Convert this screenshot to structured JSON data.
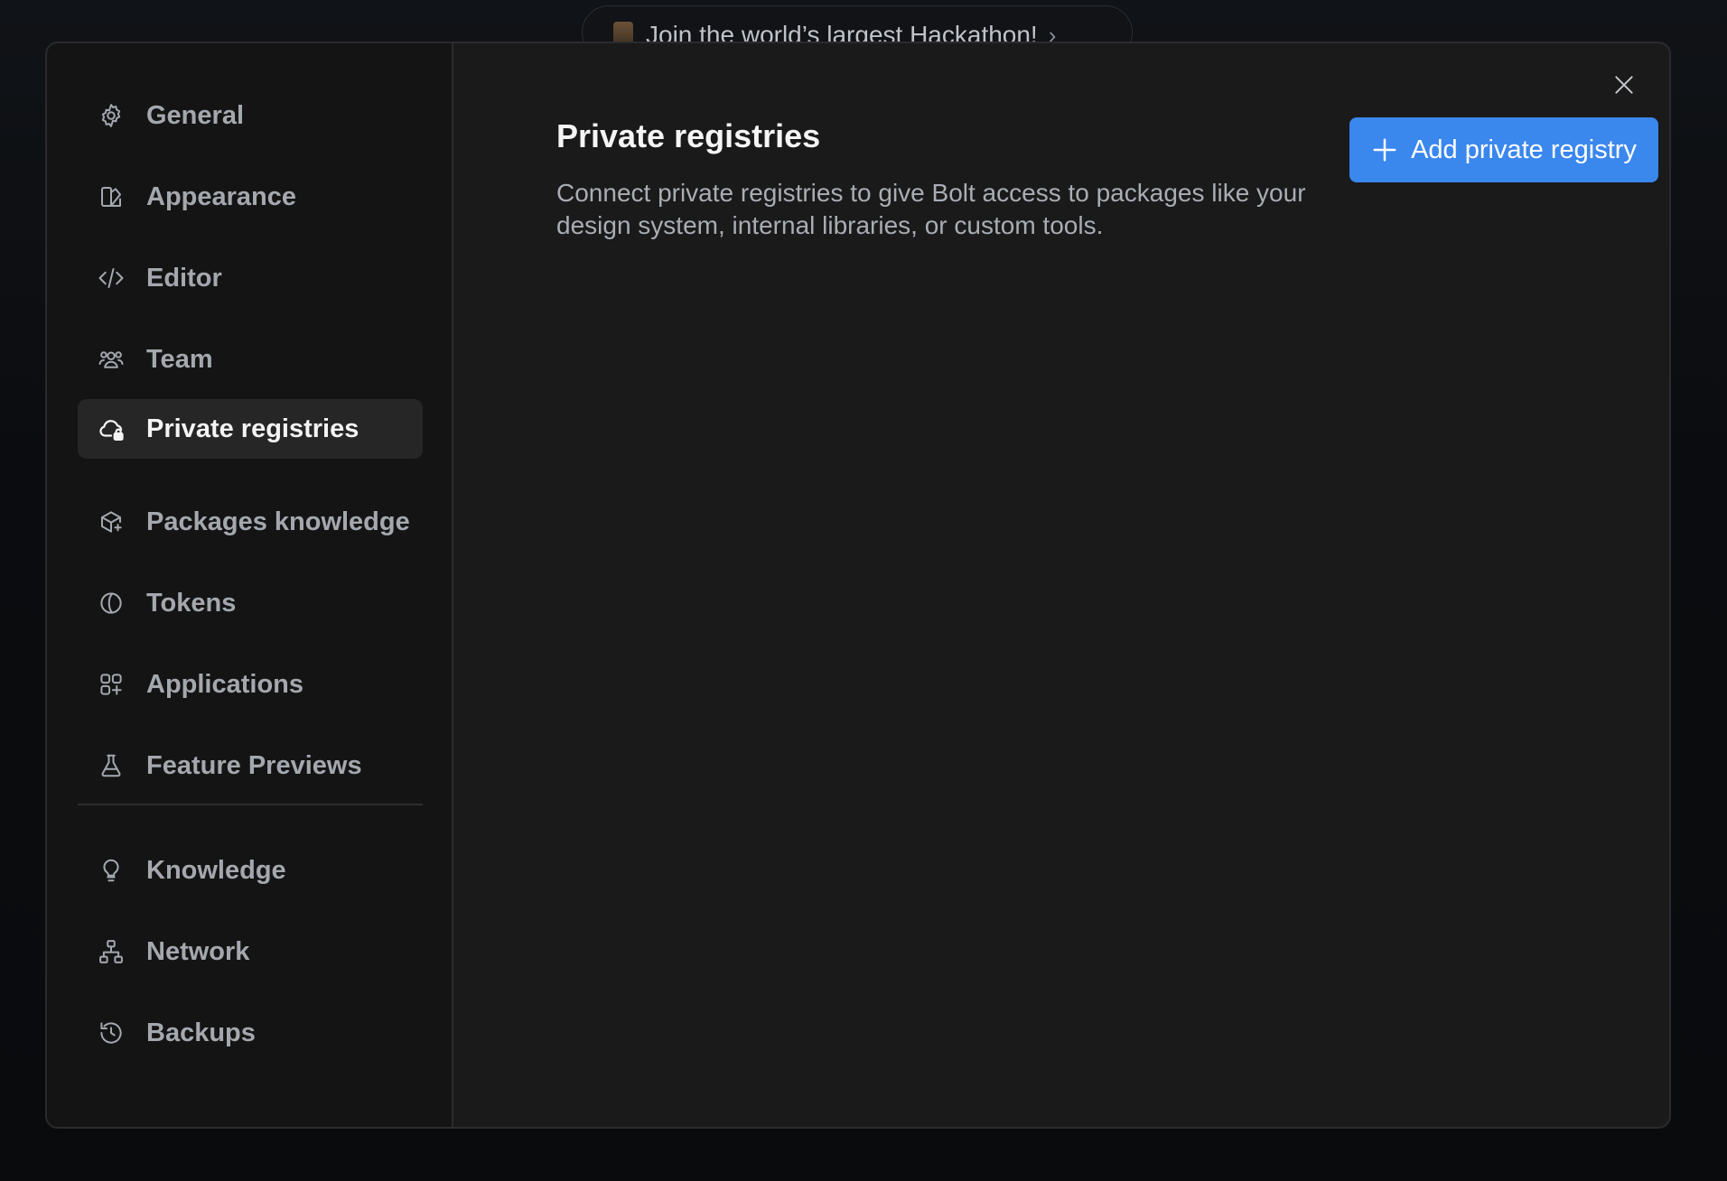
{
  "banner": {
    "text": "Join the world’s largest Hackathon!",
    "chevron": "›"
  },
  "sidebar": {
    "items": [
      {
        "label": "General",
        "icon": "gear-icon"
      },
      {
        "label": "Appearance",
        "icon": "appearance-icon"
      },
      {
        "label": "Editor",
        "icon": "code-icon"
      },
      {
        "label": "Team",
        "icon": "team-icon"
      },
      {
        "label": "Private registries",
        "icon": "cloud-lock-icon",
        "active": true
      },
      {
        "label": "Packages knowledge",
        "icon": "package-icon"
      },
      {
        "label": "Tokens",
        "icon": "token-icon"
      },
      {
        "label": "Applications",
        "icon": "apps-icon"
      },
      {
        "label": "Feature Previews",
        "icon": "flask-icon"
      }
    ],
    "secondary_items": [
      {
        "label": "Knowledge",
        "icon": "lightbulb-icon"
      },
      {
        "label": "Network",
        "icon": "network-icon"
      },
      {
        "label": "Backups",
        "icon": "history-icon"
      }
    ]
  },
  "main": {
    "title": "Private registries",
    "description": "Connect private registries to give Bolt access to packages like your design system, internal libraries, or custom tools.",
    "add_button_label": "Add private registry"
  },
  "colors": {
    "accent": "#3a87ee",
    "modal_bg": "#1a1a1a",
    "sidebar_bg": "#141414",
    "active_item_bg": "#262626"
  }
}
